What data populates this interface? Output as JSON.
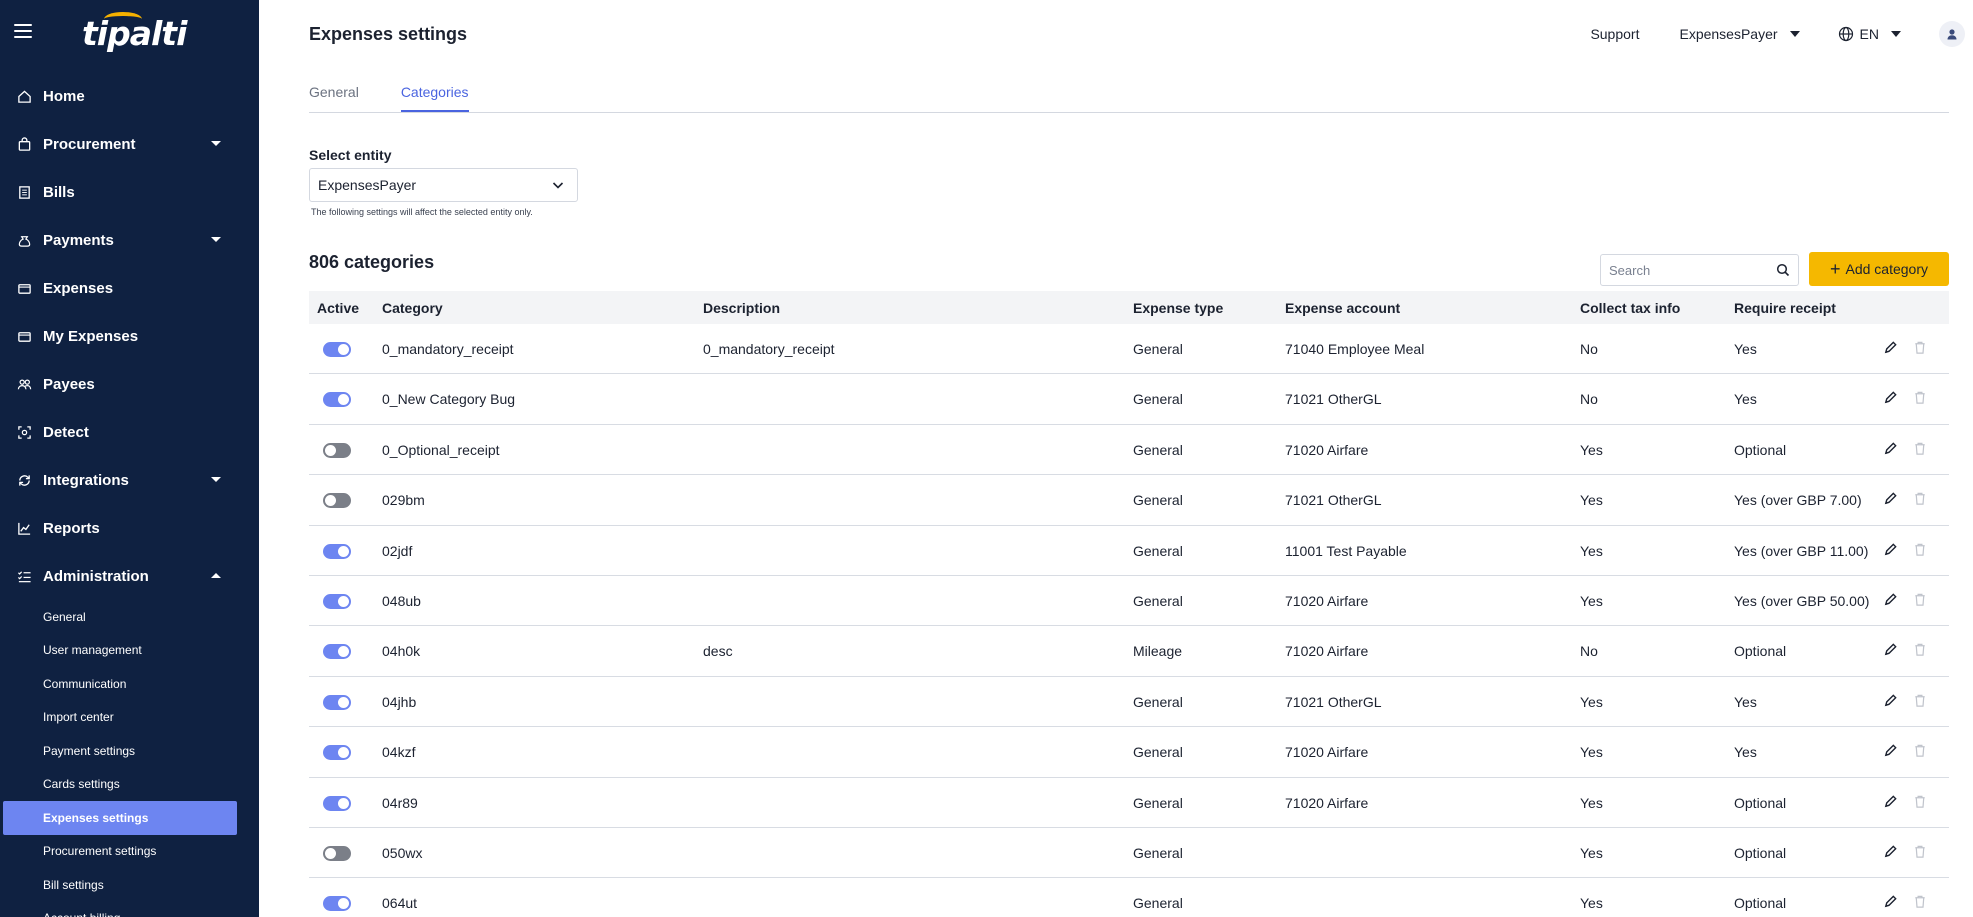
{
  "app": {
    "logo_text": "tipalti"
  },
  "sidebar": {
    "items": [
      {
        "label": "Home",
        "icon": "home-icon"
      },
      {
        "label": "Procurement",
        "icon": "bag-icon",
        "expandable": true
      },
      {
        "label": "Bills",
        "icon": "document-icon"
      },
      {
        "label": "Payments",
        "icon": "money-bag-icon",
        "expandable": true
      },
      {
        "label": "Expenses",
        "icon": "wallet-icon"
      },
      {
        "label": "My Expenses",
        "icon": "wallet-icon"
      },
      {
        "label": "Payees",
        "icon": "people-icon"
      },
      {
        "label": "Detect",
        "icon": "scan-icon"
      },
      {
        "label": "Integrations",
        "icon": "sync-icon",
        "expandable": true
      },
      {
        "label": "Reports",
        "icon": "chart-icon"
      },
      {
        "label": "Administration",
        "icon": "checklist-icon",
        "expanded": true
      }
    ],
    "admin_sub_items": [
      "General",
      "User management",
      "Communication",
      "Import center",
      "Payment settings",
      "Cards settings",
      "Expenses settings",
      "Procurement settings",
      "Bill settings",
      "Account billing"
    ],
    "active_sub_item": "Expenses settings",
    "active_color": "#6d85f1",
    "background_color": "#0f2141"
  },
  "header": {
    "title": "Expenses settings",
    "support": "Support",
    "entity": "ExpensesPayer",
    "language": "EN"
  },
  "tabs": [
    {
      "label": "General",
      "active": false
    },
    {
      "label": "Categories",
      "active": true
    }
  ],
  "entity_select": {
    "label": "Select entity",
    "value": "ExpensesPayer",
    "hint": "The following settings will affect the selected entity only."
  },
  "categories": {
    "count_label": "806 categories",
    "search_placeholder": "Search",
    "add_button": "Add category",
    "add_button_color": "#f5b800",
    "columns": [
      "Active",
      "Category",
      "Description",
      "Expense type",
      "Expense account",
      "Collect tax info",
      "Require receipt"
    ],
    "rows": [
      {
        "active": true,
        "category": "0_mandatory_receipt",
        "description": "0_mandatory_receipt",
        "type": "General",
        "account": "71040 Employee Meal",
        "tax": "No",
        "receipt": "Yes"
      },
      {
        "active": true,
        "category": "0_New Category Bug",
        "description": "",
        "type": "General",
        "account": "71021 OtherGL",
        "tax": "No",
        "receipt": "Yes"
      },
      {
        "active": false,
        "category": "0_Optional_receipt",
        "description": "",
        "type": "General",
        "account": "71020 Airfare",
        "tax": "Yes",
        "receipt": "Optional"
      },
      {
        "active": false,
        "category": "029bm",
        "description": "",
        "type": "General",
        "account": "71021 OtherGL",
        "tax": "Yes",
        "receipt": "Yes (over GBP 7.00)"
      },
      {
        "active": true,
        "category": "02jdf",
        "description": "",
        "type": "General",
        "account": "11001 Test Payable",
        "tax": "Yes",
        "receipt": "Yes (over GBP 11.00)"
      },
      {
        "active": true,
        "category": "048ub",
        "description": "",
        "type": "General",
        "account": "71020 Airfare",
        "tax": "Yes",
        "receipt": "Yes (over GBP 50.00)"
      },
      {
        "active": true,
        "category": "04h0k",
        "description": "desc",
        "type": "Mileage",
        "account": "71020 Airfare",
        "tax": "No",
        "receipt": "Optional"
      },
      {
        "active": true,
        "category": "04jhb",
        "description": "",
        "type": "General",
        "account": "71021 OtherGL",
        "tax": "Yes",
        "receipt": "Yes"
      },
      {
        "active": true,
        "category": "04kzf",
        "description": "",
        "type": "General",
        "account": "71020 Airfare",
        "tax": "Yes",
        "receipt": "Yes"
      },
      {
        "active": true,
        "category": "04r89",
        "description": "",
        "type": "General",
        "account": "71020 Airfare",
        "tax": "Yes",
        "receipt": "Optional"
      },
      {
        "active": false,
        "category": "050wx",
        "description": "",
        "type": "General",
        "account": "",
        "tax": "Yes",
        "receipt": "Optional"
      },
      {
        "active": true,
        "category": "064ut",
        "description": "",
        "type": "General",
        "account": "",
        "tax": "Yes",
        "receipt": "Optional"
      }
    ]
  }
}
